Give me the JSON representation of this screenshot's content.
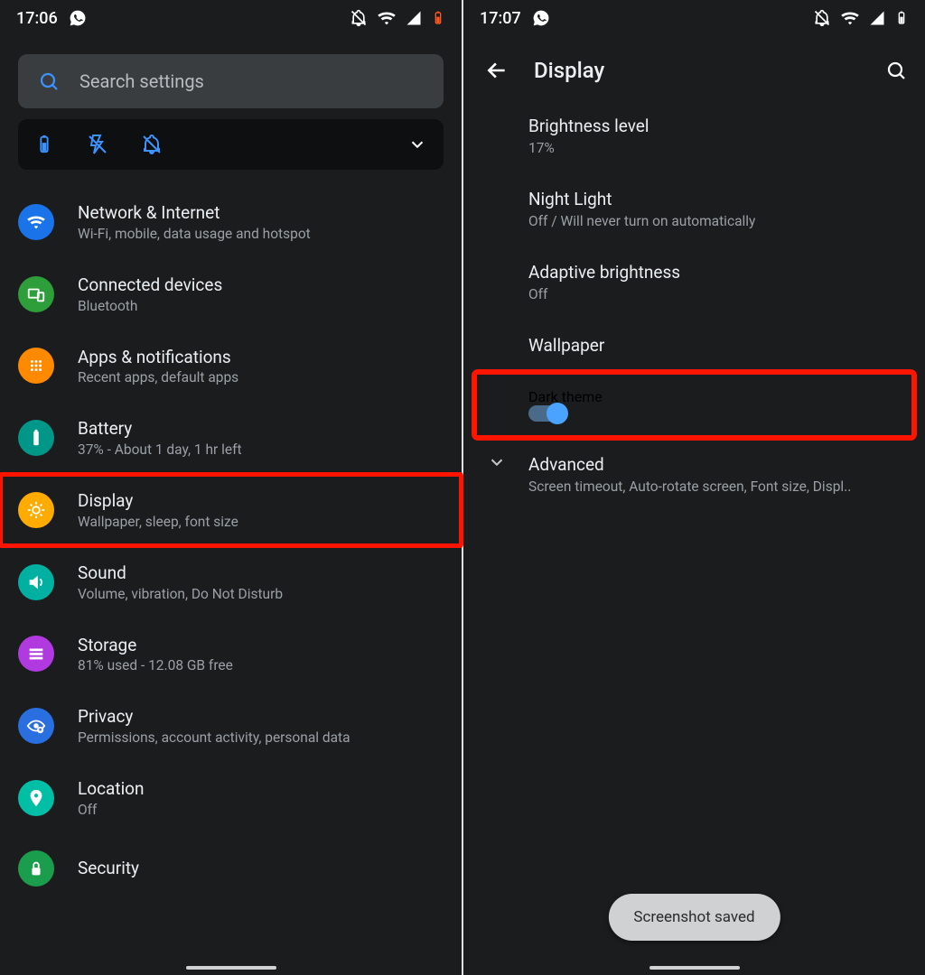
{
  "left": {
    "status": {
      "time": "17:06"
    },
    "search_placeholder": "Search settings",
    "items": [
      {
        "title": "Network & Internet",
        "sub": "Wi-Fi, mobile, data usage and hotspot",
        "color": "#1a73e8",
        "icon": "wifi"
      },
      {
        "title": "Connected devices",
        "sub": "Bluetooth",
        "color": "#2e9e3a",
        "icon": "devices"
      },
      {
        "title": "Apps & notifications",
        "sub": "Recent apps, default apps",
        "color": "#ff8a00",
        "icon": "grid"
      },
      {
        "title": "Battery",
        "sub": "37% - About 1 day, 1 hr left",
        "color": "#009688",
        "icon": "battery"
      },
      {
        "title": "Display",
        "sub": "Wallpaper, sleep, font size",
        "color": "#ffab00",
        "icon": "brightness",
        "highlight": true
      },
      {
        "title": "Sound",
        "sub": "Volume, vibration, Do Not Disturb",
        "color": "#00b0a0",
        "icon": "sound"
      },
      {
        "title": "Storage",
        "sub": "81% used - 12.08 GB free",
        "color": "#b03adf",
        "icon": "storage"
      },
      {
        "title": "Privacy",
        "sub": "Permissions, account activity, personal data",
        "color": "#2a6fe0",
        "icon": "privacy"
      },
      {
        "title": "Location",
        "sub": "Off",
        "color": "#00bfa5",
        "icon": "location"
      },
      {
        "title": "Security",
        "sub": "",
        "color": "#1a9d4c",
        "icon": "security"
      }
    ]
  },
  "right": {
    "status": {
      "time": "17:07"
    },
    "header": "Display",
    "rows": {
      "brightness": {
        "title": "Brightness level",
        "sub": "17%"
      },
      "nightlight": {
        "title": "Night Light",
        "sub": "Off / Will never turn on automatically"
      },
      "adaptive": {
        "title": "Adaptive brightness",
        "sub": "Off"
      },
      "wallpaper": {
        "title": "Wallpaper"
      },
      "dark": {
        "title": "Dark theme",
        "on": true
      },
      "advanced": {
        "title": "Advanced",
        "sub": "Screen timeout, Auto-rotate screen, Font size, Displ.."
      }
    },
    "toast": "Screenshot saved"
  }
}
